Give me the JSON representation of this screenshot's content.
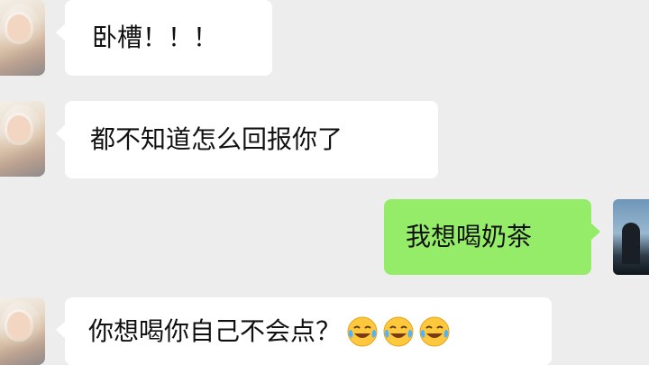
{
  "messages": [
    {
      "sender": "friend",
      "text": "卧槽！！！"
    },
    {
      "sender": "friend",
      "text": "都不知道怎么回报你了"
    },
    {
      "sender": "me",
      "text": "我想喝奶茶"
    },
    {
      "sender": "friend",
      "text": "你想喝你自己不会点？",
      "emojis": [
        "laughing-crying-emoji",
        "laughing-crying-emoji",
        "laughing-crying-emoji"
      ]
    }
  ],
  "colors": {
    "background": "#ededed",
    "incoming_bubble": "#ffffff",
    "outgoing_bubble": "#95ec69"
  }
}
